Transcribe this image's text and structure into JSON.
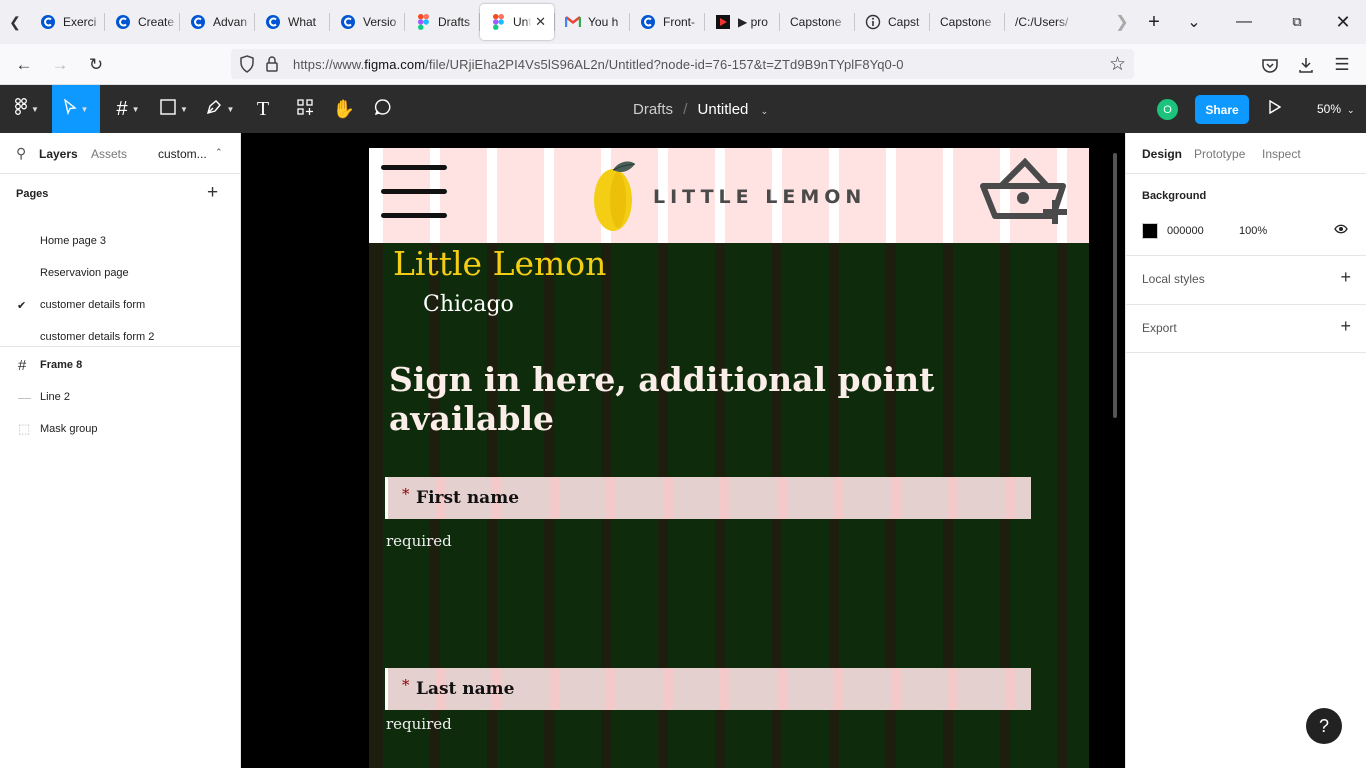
{
  "browser": {
    "tabs": [
      {
        "label": "Exerci",
        "icon": "coursera-icon"
      },
      {
        "label": "Create",
        "icon": "coursera-icon"
      },
      {
        "label": "Advan",
        "icon": "coursera-icon"
      },
      {
        "label": "What",
        "icon": "coursera-icon"
      },
      {
        "label": "Versio",
        "icon": "coursera-icon"
      },
      {
        "label": "Drafts",
        "icon": "figma-icon"
      },
      {
        "label": "Unt",
        "icon": "figma-icon",
        "active": true
      },
      {
        "label": "You h",
        "icon": "gmail-icon"
      },
      {
        "label": "Front-",
        "icon": "coursera-icon"
      },
      {
        "label": "▶ pro",
        "icon": "video-icon"
      },
      {
        "label": "Capstone",
        "icon": ""
      },
      {
        "label": "Capst",
        "icon": "info-icon"
      },
      {
        "label": "Capstone",
        "icon": ""
      },
      {
        "label": "/C:/Users/",
        "icon": ""
      }
    ],
    "url_prefix": "https://www.",
    "url_domain": "figma.com",
    "url_path": "/file/URjiEha2PI4Vs5lS96AL2n/Untitled?node-id=76-157&t=ZTd9B9nTYplF8Yq0-0"
  },
  "figma_toolbar": {
    "breadcrumb_parent": "Drafts",
    "breadcrumb_separator": "/",
    "file_name": "Untitled",
    "avatar_initial": "O",
    "share_label": "Share",
    "zoom_level": "50%"
  },
  "left_panel": {
    "tab_layers": "Layers",
    "tab_assets": "Assets",
    "page_selector": "custom...",
    "pages_title": "Pages",
    "pages": [
      {
        "name": "Home page 3"
      },
      {
        "name": "Reservavion page"
      },
      {
        "name": "customer details form",
        "selected": true
      },
      {
        "name": "customer details form 2"
      }
    ],
    "layers": [
      {
        "name": "Frame 8",
        "icon": "frame-icon"
      },
      {
        "name": "Line 2",
        "icon": "line-icon"
      },
      {
        "name": "Mask group",
        "icon": "mask-icon"
      }
    ]
  },
  "canvas": {
    "brand_wordmark": "LITTLE LEMON",
    "hero_title": "Little Lemon",
    "hero_city": "Chicago",
    "signin_heading": "Sign in here, additional point available",
    "fields": [
      {
        "required_marker": "*",
        "label": "First name",
        "hint": "required"
      },
      {
        "required_marker": "*",
        "label": "Last name",
        "hint": "required"
      }
    ],
    "colors": {
      "brand_yellow": "#F4CE14",
      "frame_bg": "#1E1E0F",
      "grid_column": "#FFC0C0"
    }
  },
  "right_panel": {
    "tab_design": "Design",
    "tab_prototype": "Prototype",
    "tab_inspect": "Inspect",
    "background_title": "Background",
    "background_hex": "000000",
    "background_opacity": "100%",
    "local_styles": "Local styles",
    "export": "Export"
  },
  "help_label": "?"
}
